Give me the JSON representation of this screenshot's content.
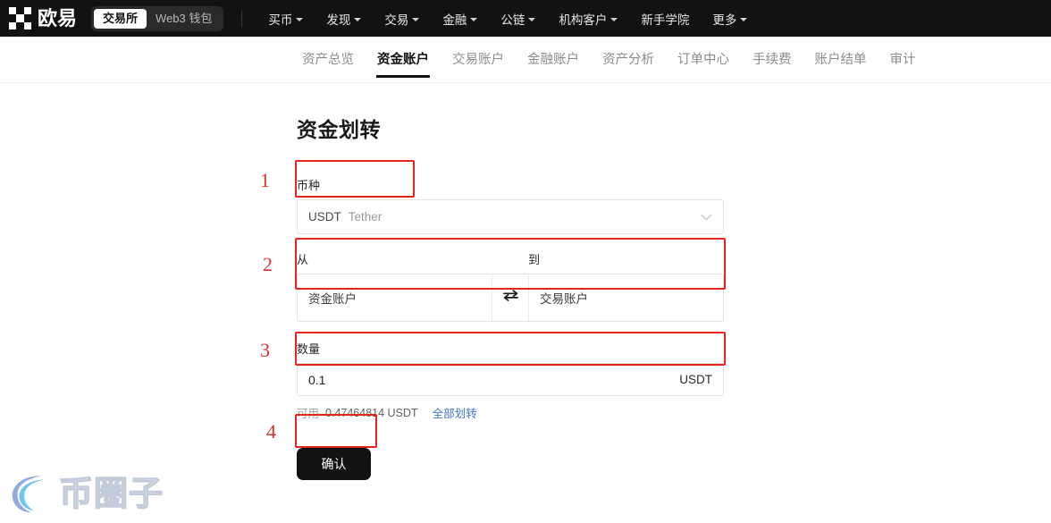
{
  "header": {
    "logo_text": "欧易",
    "logo_icon": "okx-checkerboard-logo",
    "segments": [
      {
        "label": "交易所",
        "active": true
      },
      {
        "label": "Web3 钱包",
        "active": false
      }
    ],
    "nav": [
      {
        "label": "买币",
        "has_caret": true
      },
      {
        "label": "发现",
        "has_caret": true
      },
      {
        "label": "交易",
        "has_caret": true
      },
      {
        "label": "金融",
        "has_caret": true
      },
      {
        "label": "公链",
        "has_caret": true
      },
      {
        "label": "机构客户",
        "has_caret": true
      },
      {
        "label": "新手学院",
        "has_caret": false
      },
      {
        "label": "更多",
        "has_caret": true
      }
    ]
  },
  "subnav": {
    "tabs": [
      {
        "label": "资产总览",
        "active": false
      },
      {
        "label": "资金账户",
        "active": true
      },
      {
        "label": "交易账户",
        "active": false
      },
      {
        "label": "金融账户",
        "active": false
      },
      {
        "label": "资产分析",
        "active": false
      },
      {
        "label": "订单中心",
        "active": false
      },
      {
        "label": "手续费",
        "active": false
      },
      {
        "label": "账户结单",
        "active": false
      },
      {
        "label": "审计",
        "active": false
      }
    ]
  },
  "form": {
    "title": "资金划转",
    "currency": {
      "label": "币种",
      "code": "USDT",
      "name": "Tether",
      "chevron": "chevron-down-icon"
    },
    "accounts": {
      "from_label": "从",
      "to_label": "到",
      "from_value": "资金账户",
      "to_value": "交易账户",
      "swap_icon": "swap-arrows-icon"
    },
    "amount": {
      "label": "数量",
      "value": "0.1",
      "unit": "USDT"
    },
    "balance": {
      "label": "可用",
      "value": "0.47464814 USDT",
      "link": "全部划转"
    },
    "confirm_label": "确认"
  },
  "annotations": {
    "steps": [
      "1",
      "2",
      "3",
      "4"
    ],
    "color": "#e52420"
  },
  "watermark": {
    "text": "币圈子"
  }
}
